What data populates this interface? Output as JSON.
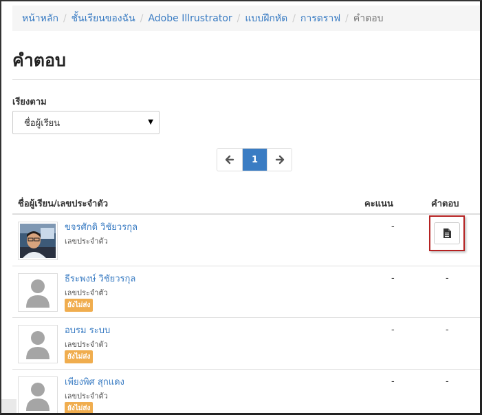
{
  "breadcrumb": [
    {
      "label": "หน้าหลัก",
      "link": true
    },
    {
      "label": "ชั้นเรียนของฉัน",
      "link": true
    },
    {
      "label": "Adobe Illrustrator",
      "link": true
    },
    {
      "label": "แบบฝึกหัด",
      "link": true
    },
    {
      "label": "การดราฟ",
      "link": true
    },
    {
      "label": "คำตอบ",
      "link": false
    }
  ],
  "page_title": "คำตอบ",
  "sort": {
    "label": "เรียงตาม",
    "selected": "ชื่อผู้เรียน"
  },
  "pagination": {
    "prev_icon": "arrow-left-icon",
    "current": "1",
    "next_icon": "arrow-right-icon"
  },
  "table": {
    "headers": {
      "name": "ชื่อผู้เรียน/เลขประจำตัว",
      "score": "คะแนน",
      "answer": "คำตอบ"
    },
    "rows": [
      {
        "name": "ขจรศักดิ วิชัยวรกุล",
        "id_label": "เลขประจำตัว",
        "badge": "",
        "score": "-",
        "answer": "document-icon",
        "avatar": "photo"
      },
      {
        "name": "ธีระพงษ์ วิชัยวรกุล",
        "id_label": "เลขประจำตัว",
        "badge": "ยังไม่ส่ง",
        "score": "-",
        "answer": "-",
        "avatar": "placeholder"
      },
      {
        "name": "อบรม ระบบ",
        "id_label": "เลขประจำตัว",
        "badge": "ยังไม่ส่ง",
        "score": "-",
        "answer": "-",
        "avatar": "placeholder"
      },
      {
        "name": "เพียงพิศ สุกแดง",
        "id_label": "เลขประจำตัว",
        "badge": "ยังไม่ส่ง",
        "score": "-",
        "answer": "-",
        "avatar": "placeholder"
      }
    ]
  },
  "colors": {
    "link": "#3a7cc3",
    "badge": "#f0ad4e",
    "highlight": "#b52222",
    "pager_active": "#3a7cc3"
  }
}
